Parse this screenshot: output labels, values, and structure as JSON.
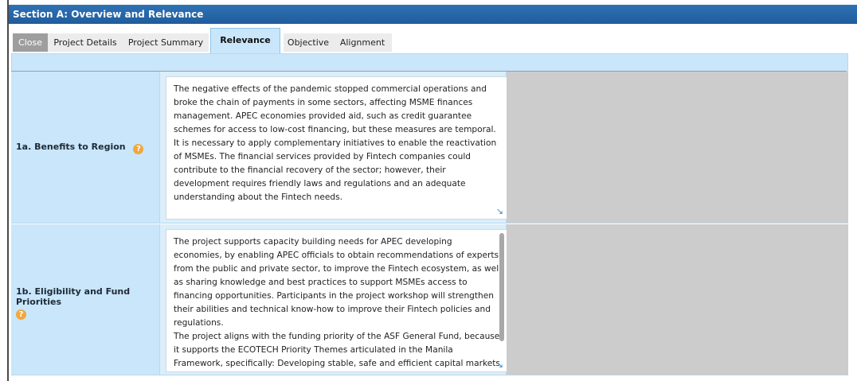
{
  "section": {
    "title": "Section A: Overview and Relevance"
  },
  "tabs": [
    {
      "label": "Close"
    },
    {
      "label": "Project Details"
    },
    {
      "label": "Project Summary"
    },
    {
      "label": "Relevance"
    },
    {
      "label": "Objective"
    },
    {
      "label": "Alignment"
    }
  ],
  "active_tab": "Relevance",
  "rows": [
    {
      "label": "1a. Benefits to Region",
      "help_icon": "?",
      "text": "The negative effects of the pandemic stopped commercial operations and broke the chain of payments in some sectors, affecting MSME finances management. APEC economies provided aid, such as credit guarantee schemes for access to low-cost financing, but these measures are temporal. It is necessary to apply complementary initiatives to enable the reactivation of MSMEs. The financial services provided by Fintech companies could contribute to the financial recovery of the sector; however, their development requires friendly laws and regulations and an adequate understanding about the Fintech needs."
    },
    {
      "label": "1b. Eligibility and Fund Priorities",
      "help_icon": "?",
      "text": "The project supports capacity building needs for APEC developing economies, by enabling APEC officials to obtain recommendations of experts from the public and private sector, to improve the Fintech ecosystem, as well as sharing knowledge and best practices to support MSMEs access to financing opportunities. Participants in the project workshop will strengthen their abilities and technical know-how to improve their Fintech policies and regulations.\nThe project aligns with the funding priority of the ASF General Fund, because it supports the ECOTECH Priority Themes articulated in the Manila Framework, specifically: Developing stable, safe and efficient capital markets through structural reform; Strengthening economic infrastructure; and"
    }
  ],
  "colors": {
    "header_bg": "#1f5c9c",
    "tab_bar_bg": "#c9e6fb",
    "help_icon": "#f2a73b",
    "gray_panel": "#cccccc"
  },
  "icons": {
    "help": "question-circle-icon",
    "resize": "resize-handle-icon"
  }
}
